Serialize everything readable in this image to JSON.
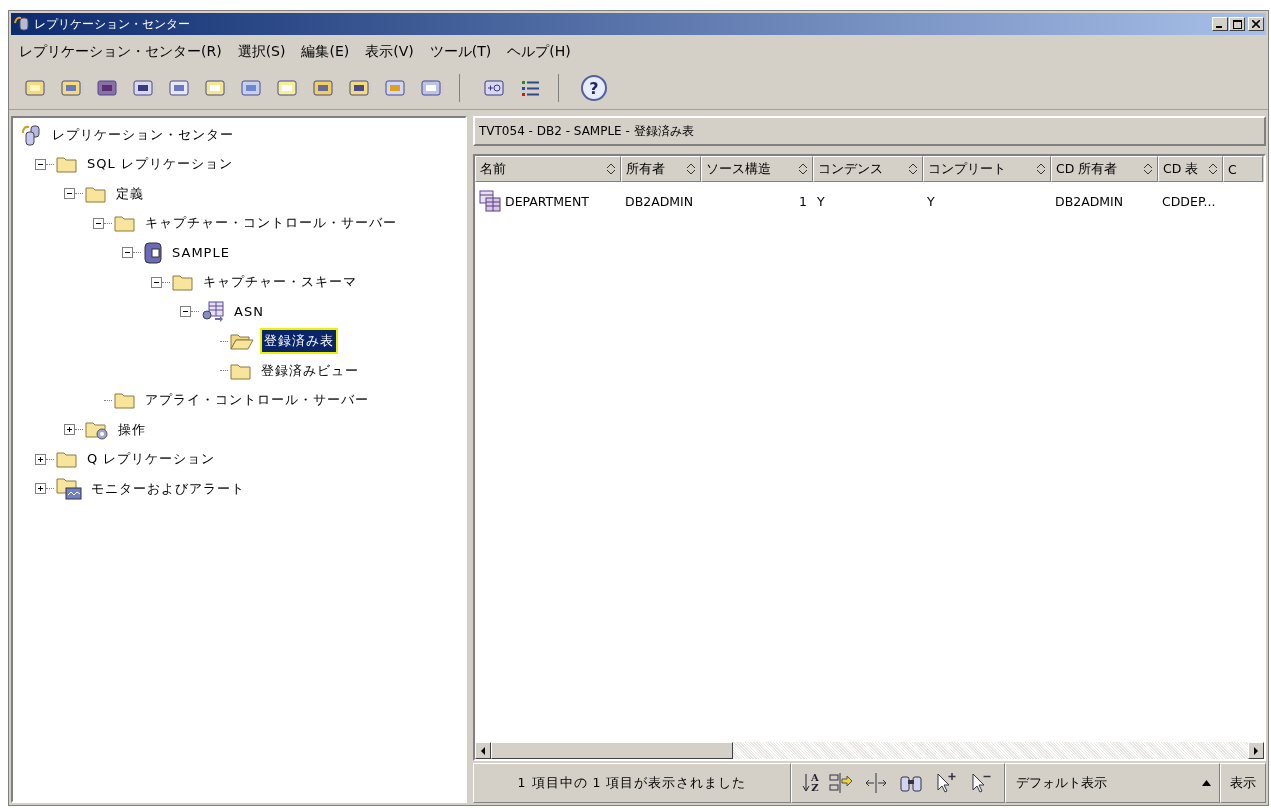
{
  "window": {
    "title": "レプリケーション・センター"
  },
  "menu": [
    "レプリケーション・センター(R)",
    "選択(S)",
    "編集(E)",
    "表示(V)",
    "ツール(T)",
    "ヘルプ(H)"
  ],
  "toolbar": {
    "help": "?"
  },
  "tree": {
    "label": "レプリケーション・センター",
    "kind": "root",
    "selected": false,
    "children": [
      {
        "label": "SQL レプリケーション",
        "kind": "folder",
        "selected": false,
        "expanded": true,
        "children": [
          {
            "label": "定義",
            "kind": "folder",
            "selected": false,
            "expanded": true,
            "children": [
              {
                "label": "キャプチャー・コントロール・サーバー",
                "kind": "folder",
                "selected": false,
                "expanded": true,
                "children": [
                  {
                    "label": "SAMPLE",
                    "kind": "database",
                    "selected": false,
                    "expanded": true,
                    "children": [
                      {
                        "label": "キャプチャー・スキーマ",
                        "kind": "folder",
                        "selected": false,
                        "expanded": true,
                        "children": [
                          {
                            "label": "ASN",
                            "kind": "schema",
                            "selected": false,
                            "expanded": true,
                            "children": [
                              {
                                "label": "登録済み表",
                                "kind": "folder-open",
                                "selected": true
                              },
                              {
                                "label": "登録済みビュー",
                                "kind": "folder",
                                "selected": false
                              }
                            ]
                          }
                        ]
                      }
                    ]
                  }
                ]
              },
              {
                "label": "アプライ・コントロール・サーバー",
                "kind": "folder",
                "selected": false
              }
            ]
          },
          {
            "label": "操作",
            "kind": "operations",
            "selected": false,
            "expanded": false
          }
        ]
      },
      {
        "label": "Q レプリケーション",
        "kind": "folder",
        "selected": false,
        "expanded": false
      },
      {
        "label": "モニターおよびアラート",
        "kind": "monitor",
        "selected": false,
        "expanded": false
      }
    ]
  },
  "content": {
    "title": "TVT054 - DB2 - SAMPLE - 登録済み表",
    "columns": [
      "名前",
      "所有者",
      "ソース構造",
      "コンデンス",
      "コンプリート",
      "CD 所有者",
      "CD 表",
      "C"
    ],
    "rows": [
      {
        "selected": false,
        "cells": [
          "DEPARTMENT",
          "DB2ADMIN",
          "1",
          "Y",
          "Y",
          "DB2ADMIN",
          "CDDEP..."
        ]
      }
    ]
  },
  "status": {
    "message": "1 項目中の 1 項目が表示されました",
    "sort_letters": [
      "A",
      "Z"
    ],
    "view": "デフォルト表示",
    "view_button": "表示"
  }
}
